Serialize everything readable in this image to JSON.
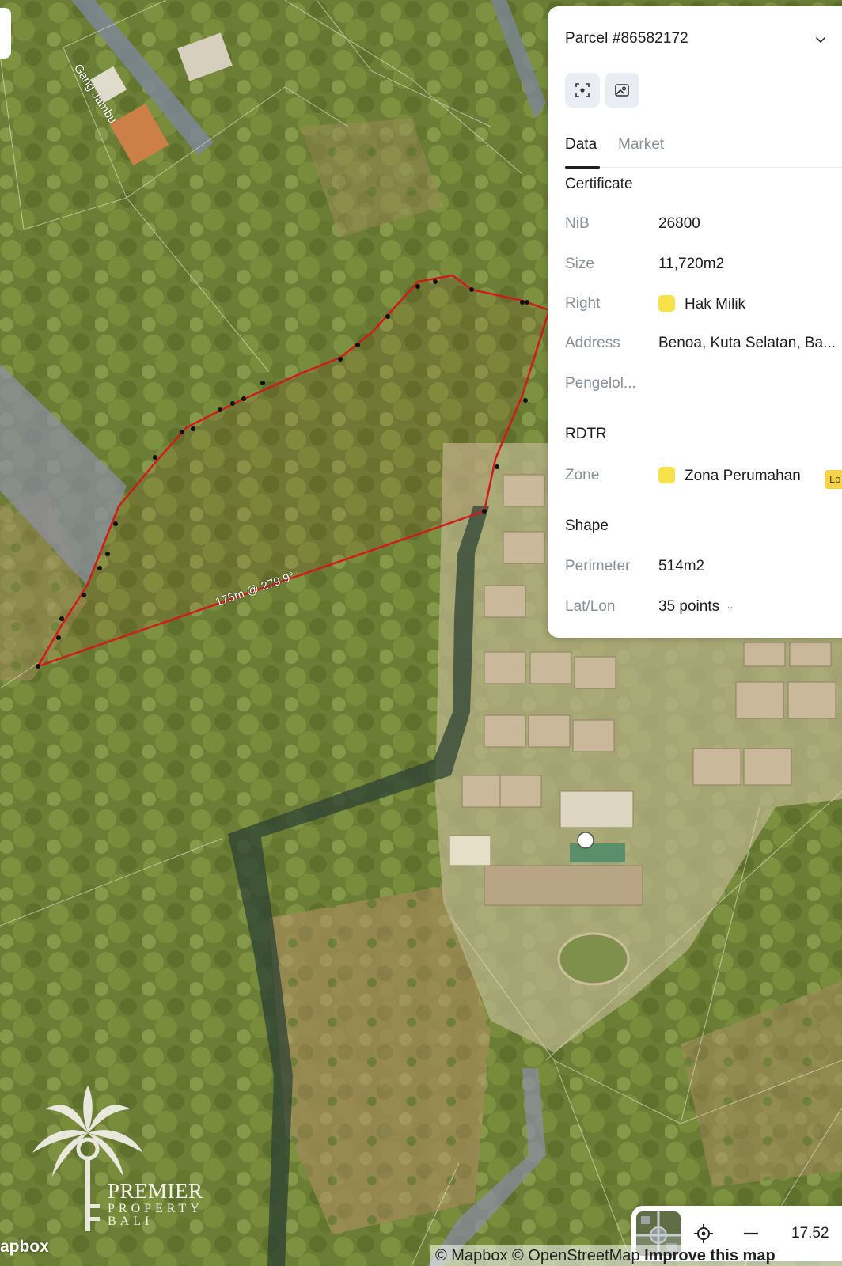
{
  "panel": {
    "parcel_title": "Parcel #86582172",
    "tabs": [
      {
        "label": "Data",
        "active": true
      },
      {
        "label": "Market",
        "active": false
      }
    ],
    "certificate": {
      "heading": "Certificate",
      "nib_label": "NiB",
      "nib_value": "26800",
      "size_label": "Size",
      "size_value": "11,720m2",
      "right_label": "Right",
      "right_value": "Hak Milik",
      "right_color": "#f7e24a",
      "address_label": "Address",
      "address_value": "Benoa, Kuta Selatan, Ba...",
      "pengelola_label": "Pengelol..."
    },
    "rdtr": {
      "heading": "RDTR",
      "zone_label": "Zone",
      "zone_value": "Zona Perumahan",
      "zone_color": "#f7e24a",
      "zone_badge": "Lo"
    },
    "shape": {
      "heading": "Shape",
      "perimeter_label": "Perimeter",
      "perimeter_value": "514m2",
      "latlon_label": "Lat/Lon",
      "latlon_value": "35 points"
    }
  },
  "map": {
    "road_label": "Gang Jambu",
    "measurement_label": "175m @ 279.9°",
    "parcel_outline_color": "#d11a1a"
  },
  "controls": {
    "zoom_level": "17.52",
    "icons": [
      "satellite-thumbnail",
      "locate-icon",
      "zoom-out-icon"
    ]
  },
  "attribution": {
    "mapbox": "© Mapbox",
    "osm": "© OpenStreetMap",
    "improve": "Improve this map",
    "logo": "apbox"
  },
  "brand": {
    "line1": "PREMIER",
    "line2": "PROPERTY",
    "line3": "BALI"
  }
}
